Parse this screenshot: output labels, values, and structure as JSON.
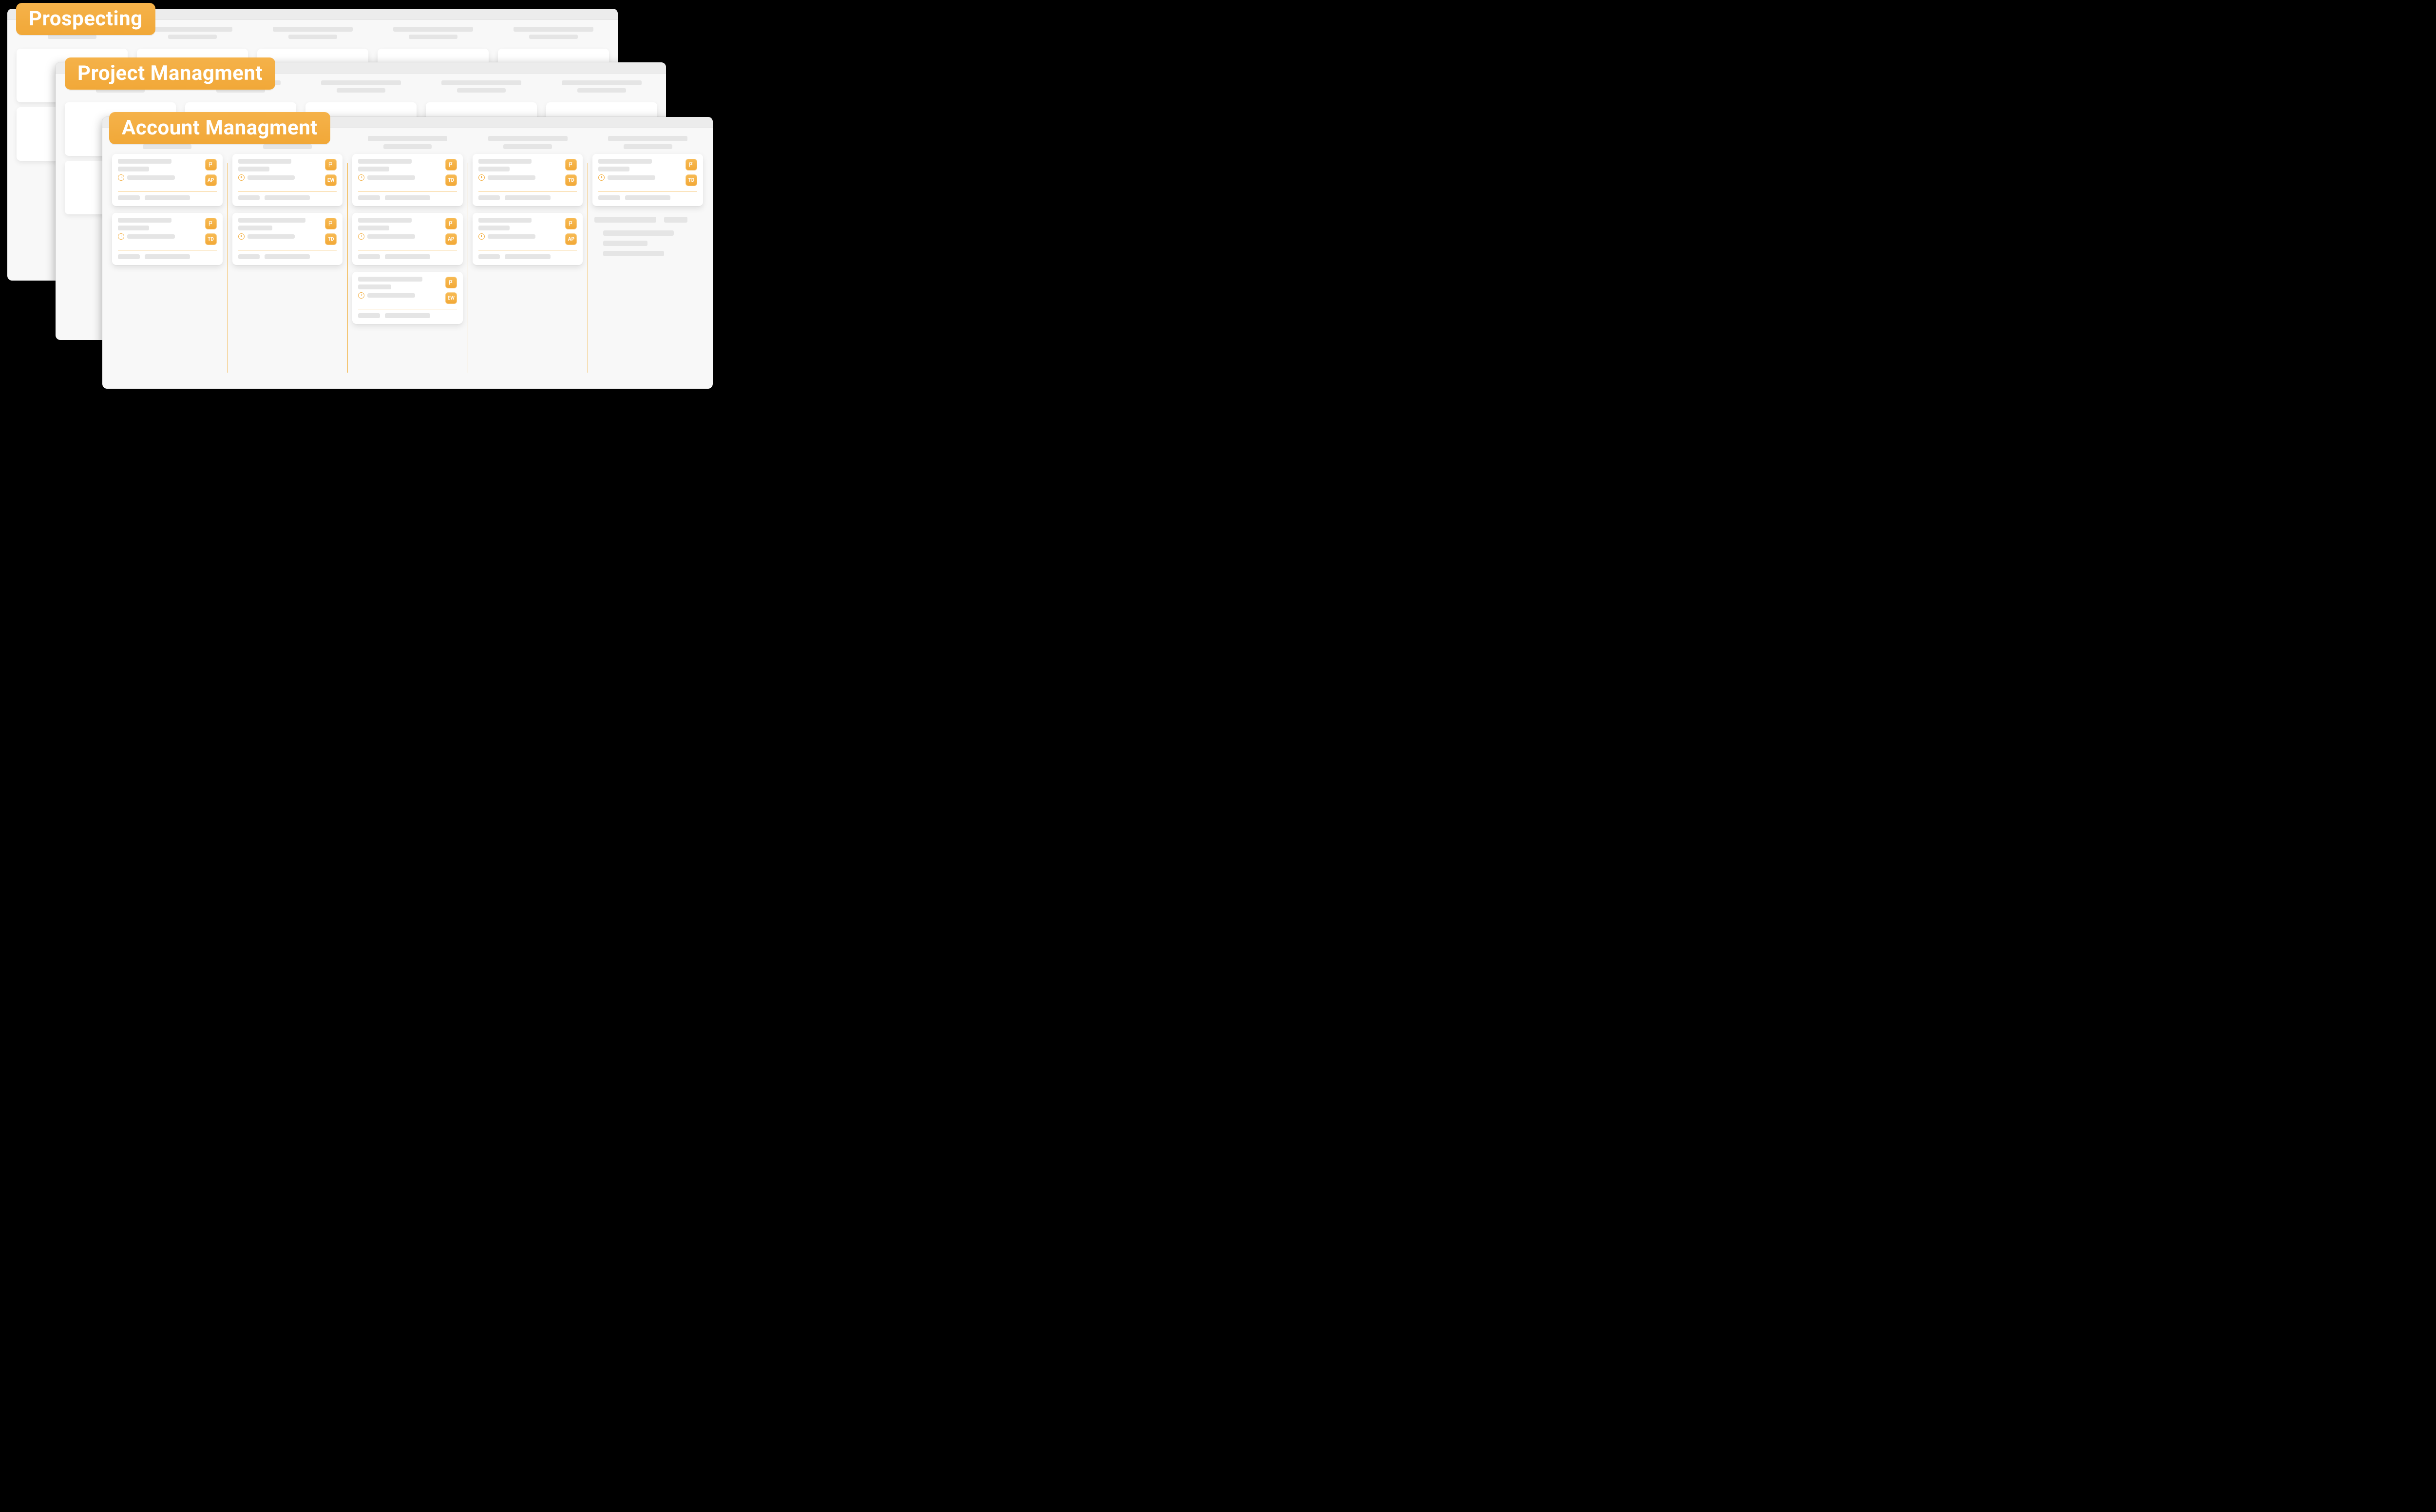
{
  "colors": {
    "accent": "#f3a93a",
    "accent_light": "#f7bb55",
    "divider": "#f3b64c",
    "placeholder": "#e5e5e5",
    "window_bg": "#f8f8f8"
  },
  "icons": {
    "flag": "flag-icon",
    "clock": "clock-icon"
  },
  "boards": [
    {
      "id": "prospecting",
      "badge": "Prospecting",
      "z": 1
    },
    {
      "id": "project-management",
      "badge": "Project Managment",
      "z": 2
    },
    {
      "id": "account-management",
      "badge": "Account Managment",
      "z": 3,
      "columns": [
        {
          "id": "col-1",
          "cards": [
            {
              "flag": true,
              "avatar": "AP"
            },
            {
              "flag": true,
              "avatar": "TD"
            }
          ]
        },
        {
          "id": "col-2",
          "cards": [
            {
              "flag": true,
              "avatar": "EW"
            },
            {
              "flag": true,
              "avatar": "TD"
            }
          ]
        },
        {
          "id": "col-3",
          "cards": [
            {
              "flag": true,
              "avatar": "TD"
            },
            {
              "flag": true,
              "avatar": "AP"
            },
            {
              "flag": true,
              "avatar": "EW"
            }
          ]
        },
        {
          "id": "col-4",
          "cards": [
            {
              "flag": true,
              "avatar": "TD"
            },
            {
              "flag": true,
              "avatar": "AP"
            }
          ]
        },
        {
          "id": "col-5",
          "cards": [
            {
              "flag": true,
              "avatar": "TD"
            }
          ],
          "add_slot": true
        }
      ]
    }
  ]
}
